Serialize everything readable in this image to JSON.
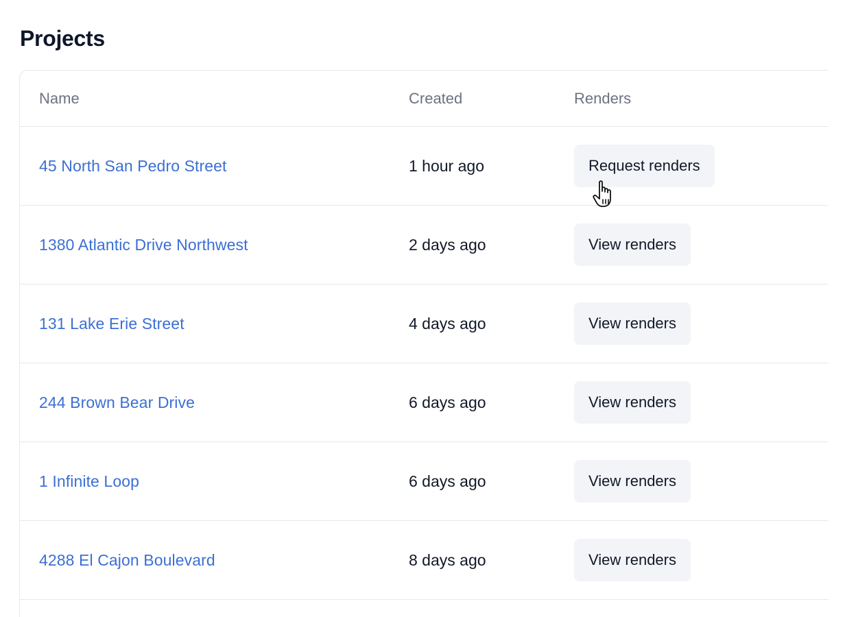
{
  "page": {
    "title": "Projects"
  },
  "table": {
    "columns": {
      "name": "Name",
      "created": "Created",
      "renders": "Renders"
    },
    "rows": [
      {
        "name": "45 North San Pedro Street",
        "created": "1 hour ago",
        "action": "Request renders"
      },
      {
        "name": "1380 Atlantic Drive Northwest",
        "created": "2 days ago",
        "action": "View renders"
      },
      {
        "name": "131 Lake Erie Street",
        "created": "4 days ago",
        "action": "View renders"
      },
      {
        "name": "244 Brown Bear Drive",
        "created": "6 days ago",
        "action": "View renders"
      },
      {
        "name": "1 Infinite Loop",
        "created": "6 days ago",
        "action": "View renders"
      },
      {
        "name": "4288 El Cajon Boulevard",
        "created": "8 days ago",
        "action": "View renders"
      }
    ]
  },
  "colors": {
    "link": "#3b6fd4",
    "header_text": "#6b7280",
    "button_bg": "#f3f4f8",
    "border": "#e5e7eb"
  },
  "icons": {
    "cursor": "hand-pointer-cursor-icon"
  }
}
